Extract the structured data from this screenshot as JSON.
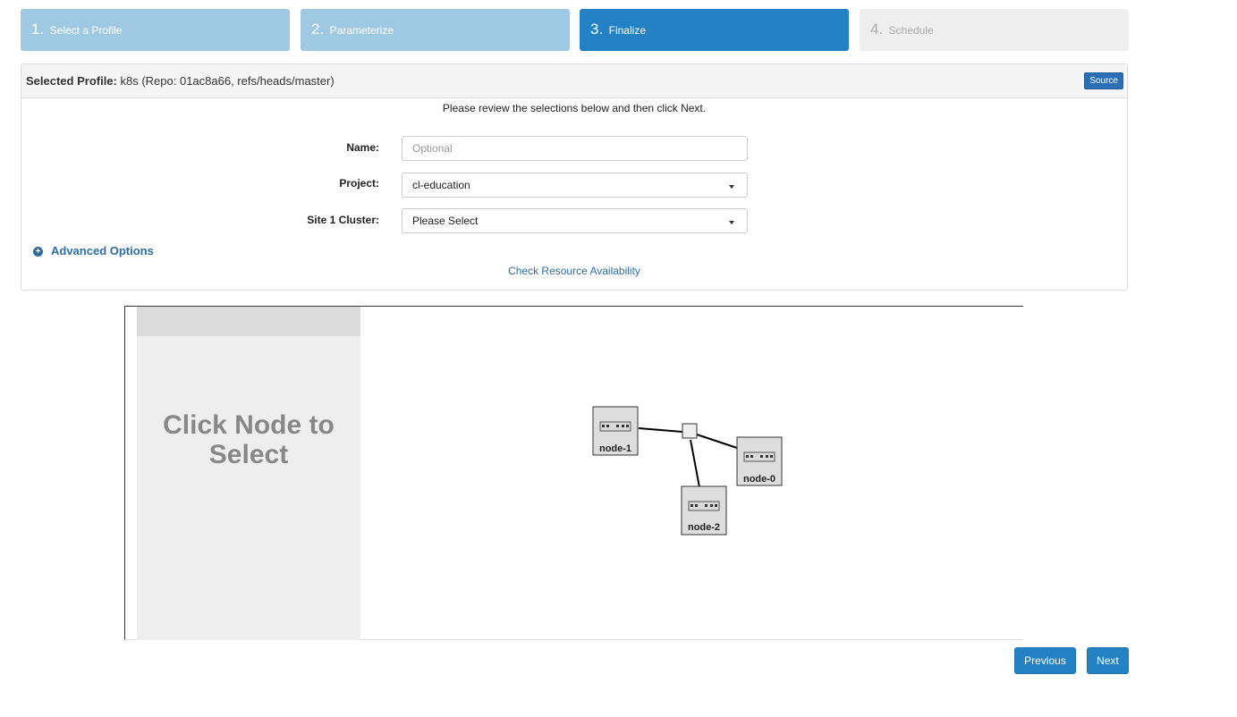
{
  "steps": [
    {
      "num": "1.",
      "label": "Select a Profile",
      "state": "done"
    },
    {
      "num": "2.",
      "label": "Parameterize",
      "state": "done"
    },
    {
      "num": "3.",
      "label": "Finalize",
      "state": "active"
    },
    {
      "num": "4.",
      "label": "Schedule",
      "state": "future"
    }
  ],
  "panel": {
    "selected_label": "Selected Profile:",
    "selected_value": "k8s (Repo: 01ac8a66, refs/heads/master)",
    "source_button": "Source",
    "review_text": "Please review the selections below and then click Next."
  },
  "form": {
    "name_label": "Name:",
    "name_placeholder": "Optional",
    "project_label": "Project:",
    "project_value": "cl-education",
    "cluster_label": "Site 1 Cluster:",
    "cluster_value": "Please Select"
  },
  "advanced_options": "Advanced Options",
  "check_resource": "Check Resource Availability",
  "topology": {
    "side_text": "Click Node to Select",
    "nodes": [
      "node-1",
      "node-0",
      "node-2"
    ]
  },
  "buttons": {
    "previous": "Previous",
    "next": "Next"
  },
  "colors": {
    "active_step": "#2481c3",
    "done_step": "#9fc9e2",
    "future_step": "#eeeeee",
    "link": "#2d6ca2"
  }
}
